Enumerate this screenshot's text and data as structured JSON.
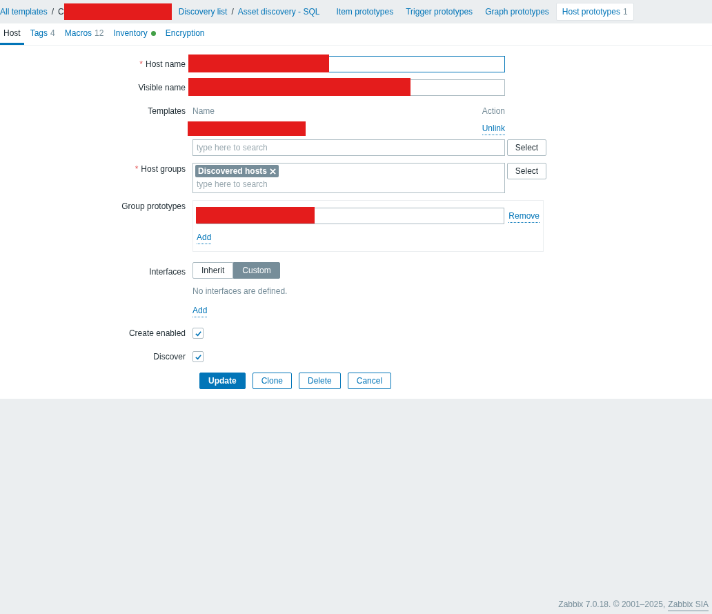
{
  "breadcrumbs": [
    {
      "kind": "link",
      "label": "All templates"
    },
    {
      "kind": "separator",
      "label": "/"
    },
    {
      "kind": "link",
      "label": "C",
      "redacted": true
    },
    {
      "kind": "link",
      "label": "Discovery list"
    },
    {
      "kind": "separator",
      "label": "/"
    },
    {
      "kind": "link",
      "label": "Asset discovery - SQL"
    }
  ],
  "nav_tabs": [
    {
      "label": "Item prototypes",
      "selected": false
    },
    {
      "label": "Trigger prototypes",
      "selected": false
    },
    {
      "label": "Graph prototypes",
      "selected": false
    },
    {
      "label": "Host prototypes",
      "count": "1",
      "selected": true
    }
  ],
  "form_tabs": [
    {
      "label": "Host",
      "selected": true
    },
    {
      "label": "Tags",
      "count": "4",
      "selected": false
    },
    {
      "label": "Macros",
      "count": "12",
      "selected": false
    },
    {
      "label": "Inventory",
      "indicator": true,
      "selected": false
    },
    {
      "label": "Encryption",
      "selected": false
    }
  ],
  "host_name": {
    "label": "Host name",
    "required_mark": "*",
    "redacted": true
  },
  "visible_name": {
    "label": "Visible name",
    "redacted": true
  },
  "templates": {
    "label": "Templates",
    "name_header": "Name",
    "action_header": "Action",
    "rows": [
      {
        "redacted": true,
        "action": "Unlink"
      }
    ],
    "search": {
      "placeholder": "type here to search"
    },
    "select_button": "Select"
  },
  "host_groups": {
    "label": "Host groups",
    "required_mark": "*",
    "chips": [
      "Discovered hosts"
    ],
    "search": {
      "placeholder": "type here to search"
    },
    "select_button": "Select"
  },
  "group_prototypes": {
    "label": "Group prototypes",
    "rows": [
      {
        "redacted": true,
        "action": "Remove"
      }
    ],
    "add_link": "Add"
  },
  "interfaces": {
    "label": "Interfaces",
    "options": [
      {
        "label": "Inherit",
        "selected": false
      },
      {
        "label": "Custom",
        "selected": true
      }
    ],
    "empty_text": "No interfaces are defined.",
    "add_link": "Add"
  },
  "checkboxes": [
    {
      "label": "Create enabled",
      "checked": true
    },
    {
      "label": "Discover",
      "checked": true
    }
  ],
  "buttons": [
    {
      "label": "Update",
      "kind": "primary"
    },
    {
      "label": "Clone",
      "kind": "secondary"
    },
    {
      "label": "Delete",
      "kind": "secondary"
    },
    {
      "label": "Cancel",
      "kind": "secondary"
    }
  ],
  "footer": {
    "text": "Zabbix 7.0.18. © 2001–2025,",
    "link": "Zabbix SIA"
  }
}
